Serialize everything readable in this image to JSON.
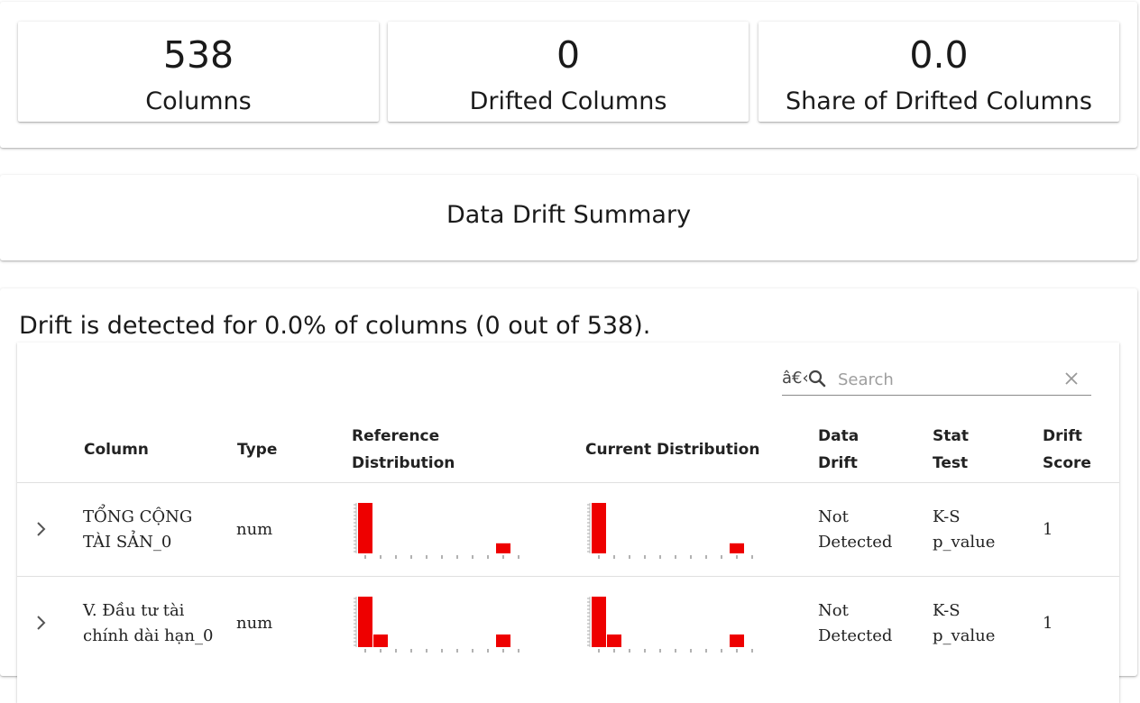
{
  "metrics": [
    {
      "value": "538",
      "label": "Columns"
    },
    {
      "value": "0",
      "label": "Drifted Columns"
    },
    {
      "value": "0.0",
      "label": "Share of Drifted Columns"
    }
  ],
  "summary_title": "Data Drift Summary",
  "drift_message": "Drift is detected for 0.0% of columns (0 out of 538).",
  "search": {
    "prefix": "â€‹",
    "placeholder": "Search"
  },
  "table": {
    "headers": {
      "column": "Column",
      "type": "Type",
      "reference_distribution": "Reference\nDistribution",
      "current_distribution": "Current Distribution",
      "data_drift": "Data\nDrift",
      "stat_test": "Stat\nTest",
      "drift_score": "Drift\nScore"
    },
    "rows": [
      {
        "column": "TỔNG CỘNG TÀI SẢN_0",
        "type": "num",
        "data_drift": "Not Detected",
        "stat_test": "K-S p_value",
        "drift_score": "1",
        "reference_hist": [
          1.0,
          0,
          0,
          0,
          0,
          0,
          0,
          0,
          0,
          0.2
        ],
        "current_hist": [
          1.0,
          0,
          0,
          0,
          0,
          0,
          0,
          0,
          0,
          0.2
        ]
      },
      {
        "column": "V. Đầu tư tài chính dài hạn_0",
        "type": "num",
        "data_drift": "Not Detected",
        "stat_test": "K-S p_value",
        "drift_score": "1",
        "reference_hist": [
          1.0,
          0.25,
          0,
          0,
          0,
          0,
          0,
          0,
          0,
          0.25
        ],
        "current_hist": [
          1.0,
          0.25,
          0,
          0,
          0,
          0,
          0,
          0,
          0,
          0.25
        ]
      }
    ]
  },
  "colors": {
    "bar": "#ee0000"
  }
}
